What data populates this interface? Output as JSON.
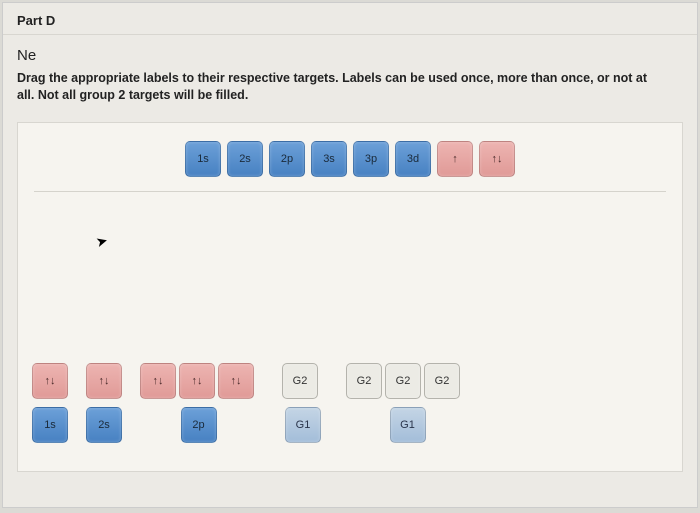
{
  "header": {
    "part": "Part D"
  },
  "element": "Ne",
  "instructions": "Drag the appropriate labels to their respective targets. Labels can be used once, more than once, or not at all. Not all group 2 targets will be filled.",
  "palette": {
    "orbitals": [
      "1s",
      "2s",
      "2p",
      "3s",
      "3p",
      "3d"
    ],
    "spins": [
      "↑",
      "↑↓"
    ]
  },
  "targets": {
    "row": [
      {
        "drop": "↑↓",
        "label": "1s"
      },
      {
        "drop": "↑↓",
        "label": "2s"
      },
      {
        "group": [
          "↑↓",
          "↑↓",
          "↑↓"
        ],
        "label": "2p"
      },
      {
        "g1": "G1",
        "g2_group": [
          "G2"
        ]
      },
      {
        "g1": "G1",
        "g2_group": [
          "G2",
          "G2",
          "G2"
        ]
      }
    ]
  }
}
